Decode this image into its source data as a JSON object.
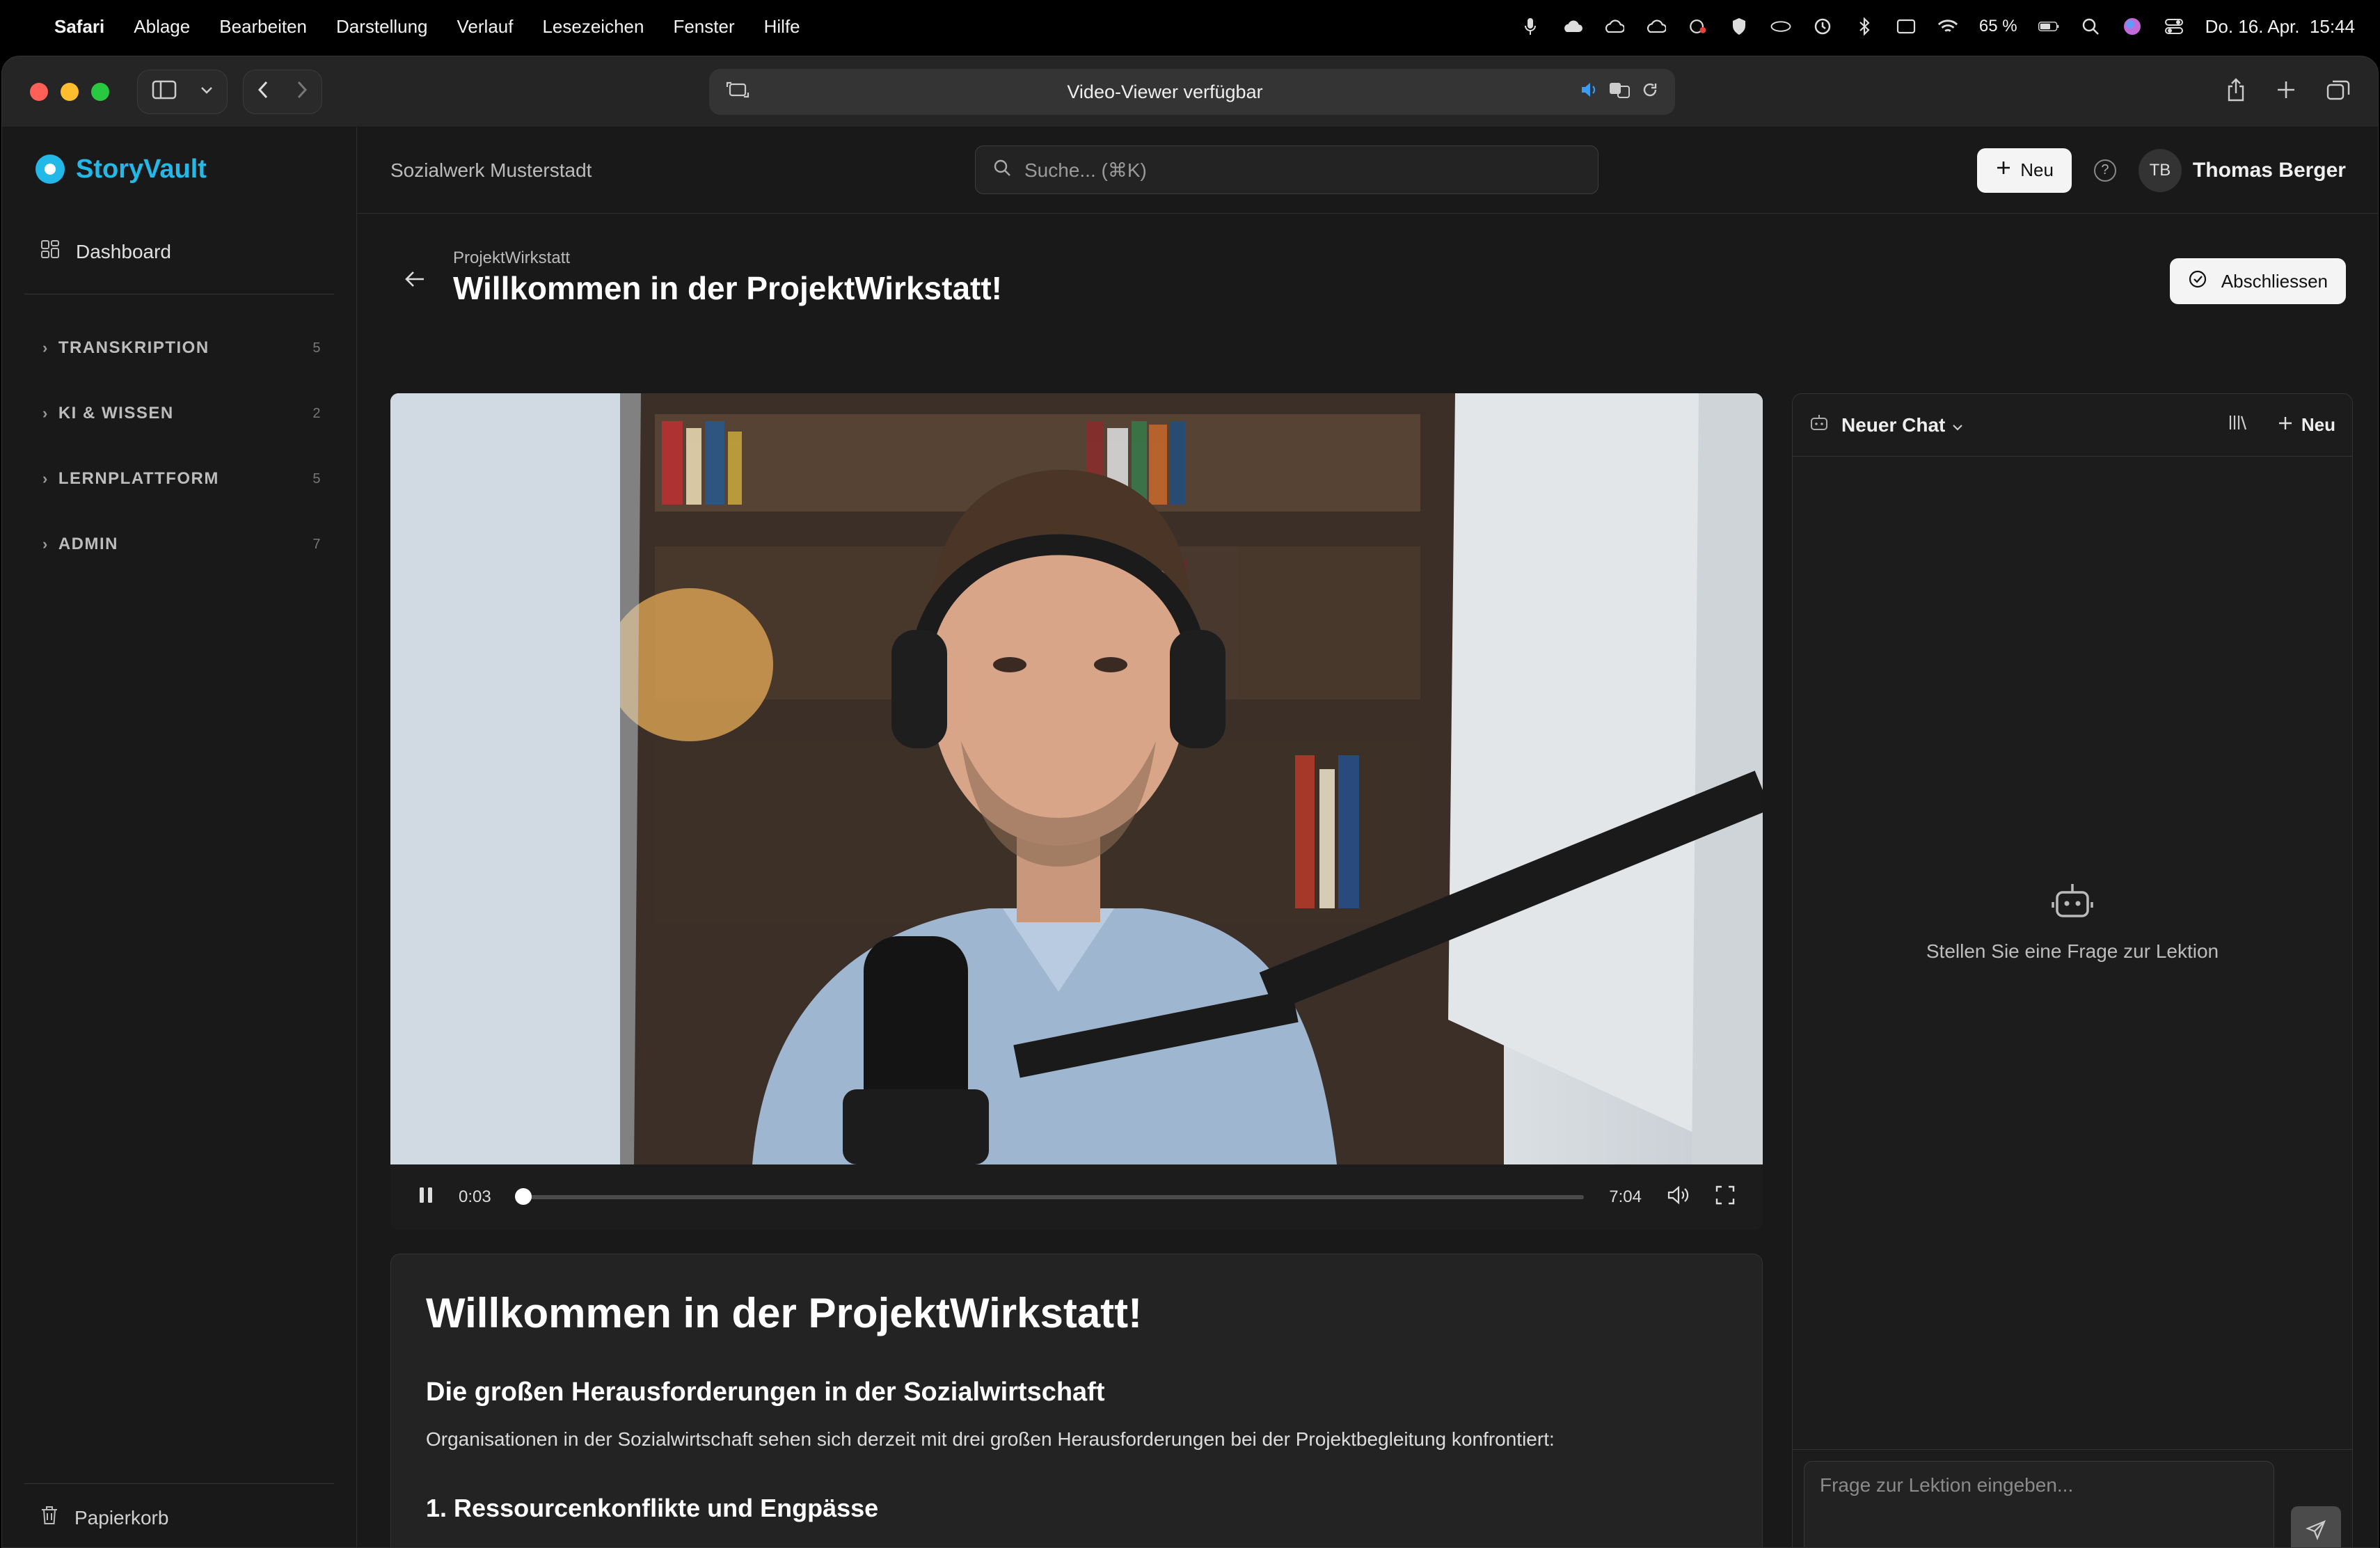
{
  "menubar": {
    "app": "Safari",
    "items": [
      "Ablage",
      "Bearbeiten",
      "Darstellung",
      "Verlauf",
      "Lesezeichen",
      "Fenster",
      "Hilfe"
    ],
    "battery": "65 %",
    "datetime": "Do. 16. Apr.  15:44"
  },
  "browser": {
    "address_text": "Video-Viewer verfügbar"
  },
  "app": {
    "brand": "StoryVault",
    "org": "Sozialwerk Musterstadt",
    "search_placeholder": "Suche... (⌘K)",
    "new_label": "Neu",
    "user_initials": "TB",
    "user_name": "Thomas Berger"
  },
  "sidebar": {
    "dashboard": "Dashboard",
    "sections": [
      {
        "label": "TRANSKRIPTION",
        "count": "5"
      },
      {
        "label": "KI & WISSEN",
        "count": "2"
      },
      {
        "label": "LERNPLATTFORM",
        "count": "5"
      },
      {
        "label": "ADMIN",
        "count": "7"
      }
    ],
    "trash": "Papierkorb"
  },
  "page": {
    "breadcrumb": "ProjektWirkstatt",
    "title": "Willkommen in der ProjektWirkstatt!",
    "complete_label": "Abschliessen"
  },
  "video": {
    "current_time": "0:03",
    "duration": "7:04",
    "progress": 0.007
  },
  "lesson": {
    "h1": "Willkommen in der ProjektWirkstatt!",
    "h2": "Die großen Herausforderungen in der Sozialwirtschaft",
    "p": "Organisationen in der Sozialwirtschaft sehen sich derzeit mit drei großen Herausforderungen bei der Projektbegleitung konfrontiert:",
    "h3": "1. Ressourcenkonflikte und Engpässe"
  },
  "chat": {
    "title": "Neuer Chat",
    "new_label": "Neu",
    "empty_text": "Stellen Sie eine Frage zur Lektion",
    "input_placeholder": "Frage zur Lektion eingeben..."
  },
  "colors": {
    "accent": "#22b8e8",
    "background": "#191919"
  }
}
